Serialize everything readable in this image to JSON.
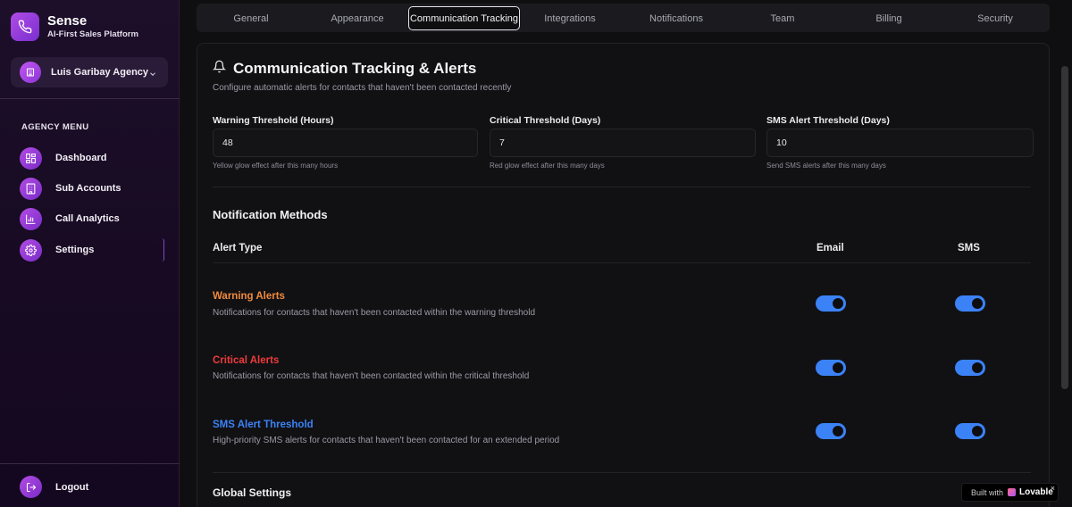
{
  "brand": {
    "name": "Sense",
    "tagline": "AI-First Sales Platform"
  },
  "agency": {
    "name": "Luis Garibay Agency"
  },
  "menu": {
    "title": "AGENCY MENU",
    "items": [
      {
        "label": "Dashboard",
        "icon": "dashboard-icon"
      },
      {
        "label": "Sub Accounts",
        "icon": "building-icon"
      },
      {
        "label": "Call Analytics",
        "icon": "bar-chart-icon"
      },
      {
        "label": "Settings",
        "icon": "gear-icon",
        "active": true
      }
    ],
    "logout": "Logout"
  },
  "tabs": [
    "General",
    "Appearance",
    "Communication Tracking",
    "Integrations",
    "Notifications",
    "Team",
    "Billing",
    "Security"
  ],
  "active_tab": "Communication Tracking",
  "section": {
    "title": "Communication Tracking & Alerts",
    "description": "Configure automatic alerts for contacts that haven't been contacted recently"
  },
  "fields": [
    {
      "label": "Warning Threshold (Hours)",
      "value": "48",
      "hint": "Yellow glow effect after this many hours"
    },
    {
      "label": "Critical Threshold (Days)",
      "value": "7",
      "hint": "Red glow effect after this many days"
    },
    {
      "label": "SMS Alert Threshold (Days)",
      "value": "10",
      "hint": "Send SMS alerts after this many days"
    }
  ],
  "notification_methods": {
    "title": "Notification Methods",
    "columns": {
      "type": "Alert Type",
      "email": "Email",
      "sms": "SMS"
    },
    "rows": [
      {
        "title": "Warning Alerts",
        "desc": "Notifications for contacts that haven't been contacted within the warning threshold",
        "color": "#f08a3c",
        "email": true,
        "sms": true
      },
      {
        "title": "Critical Alerts",
        "desc": "Notifications for contacts that haven't been contacted within the critical threshold",
        "color": "#ee3b3b",
        "email": true,
        "sms": true
      },
      {
        "title": "SMS Alert Threshold",
        "desc": "High-priority SMS alerts for contacts that haven't been contacted for an extended period",
        "color": "#3b82f6",
        "email": true,
        "sms": true
      }
    ]
  },
  "global_settings": {
    "title": "Global Settings"
  },
  "badge": {
    "prefix": "Built with",
    "brand": "Lovable",
    "close": "×"
  },
  "colors": {
    "accent": "#3b82f6",
    "sidebar_bg": "#1d0f2a",
    "brand_purple": "#b04be6"
  }
}
